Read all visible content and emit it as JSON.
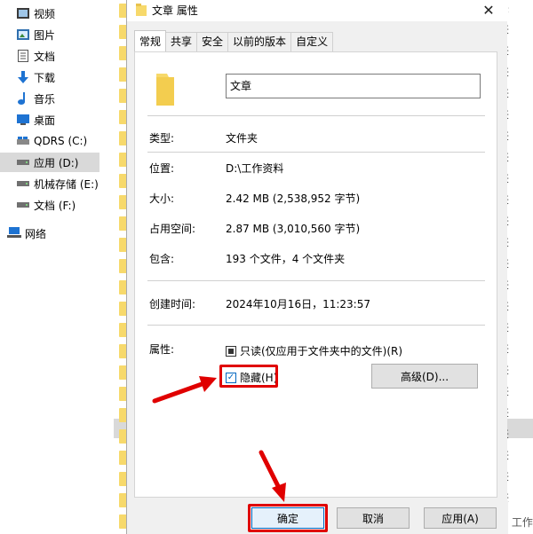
{
  "sidebar": {
    "items": [
      {
        "label": "视频",
        "icon": "video-icon"
      },
      {
        "label": "图片",
        "icon": "pictures-icon"
      },
      {
        "label": "文档",
        "icon": "documents-icon"
      },
      {
        "label": "下载",
        "icon": "download-icon"
      },
      {
        "label": "音乐",
        "icon": "music-icon"
      },
      {
        "label": "桌面",
        "icon": "desktop-icon"
      },
      {
        "label": "QDRS (C:)",
        "icon": "drive-c-icon"
      },
      {
        "label": "应用 (D:)",
        "icon": "drive-icon",
        "selected": true
      },
      {
        "label": "机械存储 (E:)",
        "icon": "drive-icon"
      },
      {
        "label": "文档 (F:)",
        "icon": "drive-icon"
      },
      {
        "label": "网络",
        "icon": "network-icon"
      }
    ]
  },
  "background": {
    "right_column_char": "夹",
    "bottom_text": "《 工作表"
  },
  "dialog": {
    "title": "文章 属性",
    "close_glyph": "✕",
    "tabs": [
      "常规",
      "共享",
      "安全",
      "以前的版本",
      "自定义"
    ],
    "active_tab": 0,
    "name_value": "文章",
    "details": [
      {
        "label": "类型:",
        "value": "文件夹"
      },
      {
        "label": "位置:",
        "value": "D:\\工作资料"
      },
      {
        "label": "大小:",
        "value": "2.42 MB (2,538,952 字节)"
      },
      {
        "label": "占用空间:",
        "value": "2.87 MB (3,010,560 字节)"
      },
      {
        "label": "包含:",
        "value": "193 个文件，4 个文件夹"
      },
      {
        "label": "创建时间:",
        "value": "2024年10月16日，11:23:57"
      }
    ],
    "attributes_label": "属性:",
    "readonly_label": "只读(仅应用于文件夹中的文件)(R)",
    "hidden_label": "隐藏(H)",
    "hidden_checked": true,
    "advanced_button": "高级(D)...",
    "ok_button": "确定",
    "cancel_button": "取消",
    "apply_button": "应用(A)"
  },
  "colors": {
    "highlight": "#e00000",
    "folder": "#f7d96b",
    "accent": "#0067c0"
  }
}
